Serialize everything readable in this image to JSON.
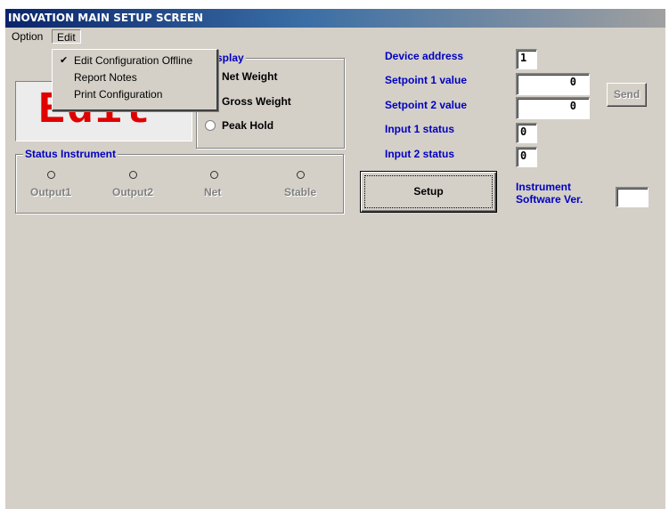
{
  "window": {
    "title": "INOVATION MAIN SETUP SCREEN"
  },
  "menubar": {
    "option_label": "Option",
    "edit_label": "Edit"
  },
  "edit_menu": {
    "items": [
      {
        "label": "Edit Configuration Offline",
        "checked": true
      },
      {
        "label": "Report Notes",
        "checked": false
      },
      {
        "label": "Print Configuration",
        "checked": false
      }
    ]
  },
  "display_panel": {
    "big_text": "Edit"
  },
  "display_group": {
    "label": "Display",
    "options": [
      "Net Weight",
      "Gross Weight",
      "Peak Hold"
    ]
  },
  "status_group": {
    "label": "Status Instrument",
    "indicators": [
      "Output1",
      "Output2",
      "Net",
      "Stable"
    ]
  },
  "device": {
    "address_label": "Device address",
    "address_value": "1",
    "setpoint1_label": "Setpoint 1 value",
    "setpoint1_value": "0",
    "setpoint2_label": "Setpoint 2 value",
    "setpoint2_value": "0",
    "input1_label": "Input 1 status",
    "input1_value": "0",
    "input2_label": "Input 2 status",
    "input2_value": "0",
    "send_label": "Send",
    "setup_label": "Setup",
    "software_label_line1": "Instrument",
    "software_label_line2": "Software Ver.",
    "software_value": ""
  }
}
